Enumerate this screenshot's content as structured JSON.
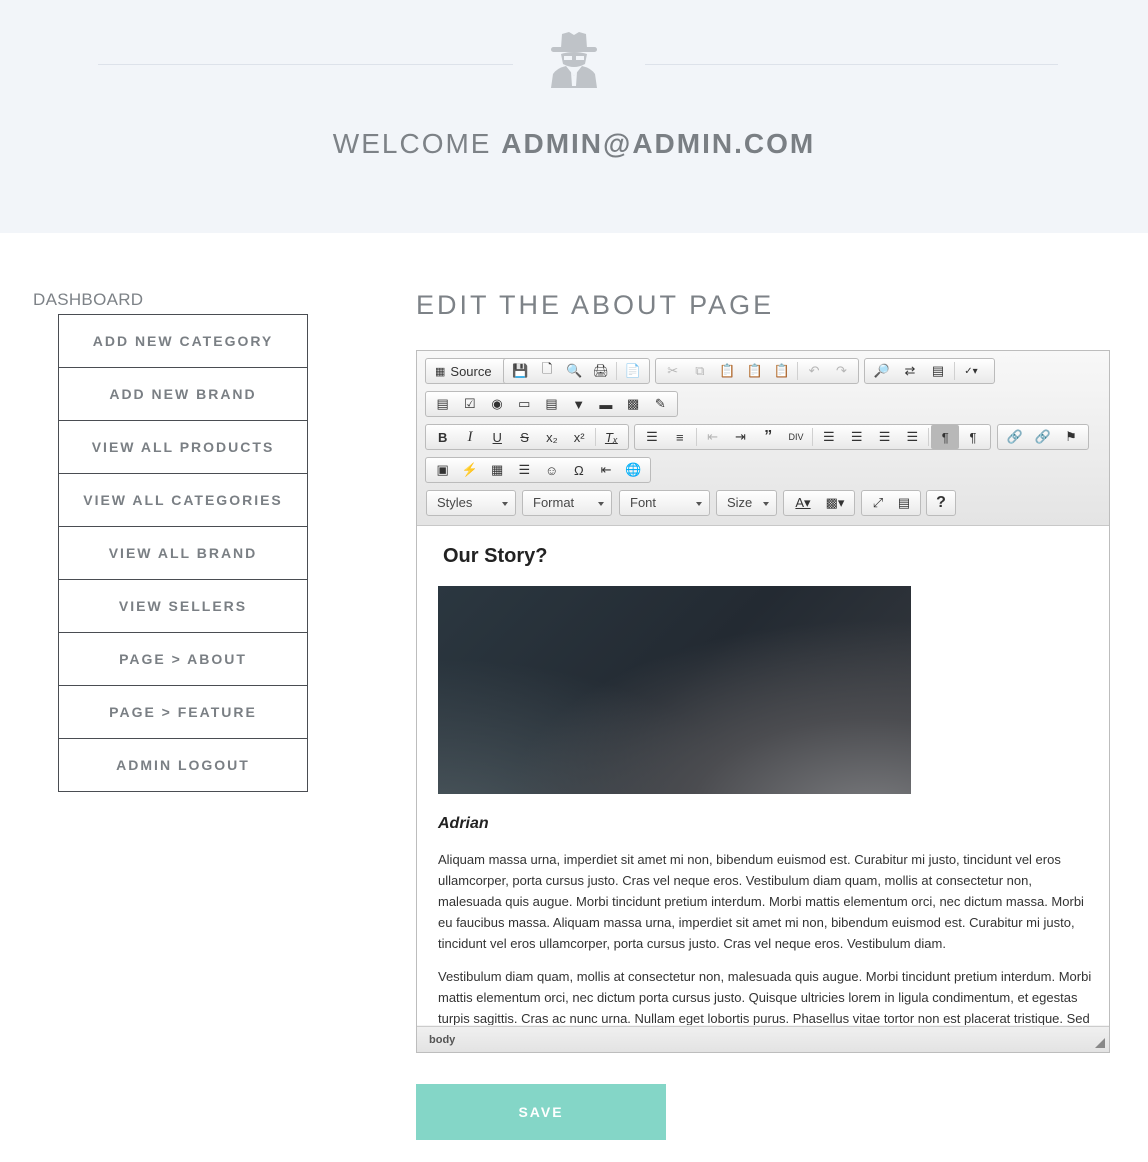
{
  "header": {
    "welcome_prefix": "WELCOME ",
    "welcome_user": "ADMIN@ADMIN.COM",
    "logo_icon": "spy-icon"
  },
  "sidebar": {
    "title": "DASHBOARD",
    "items": [
      {
        "label": "ADD NEW CATEGORY"
      },
      {
        "label": "ADD NEW BRAND"
      },
      {
        "label": "VIEW ALL PRODUCTS"
      },
      {
        "label": "VIEW ALL CATEGORIES"
      },
      {
        "label": "VIEW ALL BRAND"
      },
      {
        "label": "VIEW SELLERS"
      },
      {
        "label": "PAGE > ABOUT"
      },
      {
        "label": "PAGE > FEATURE"
      },
      {
        "label": "ADMIN LOGOUT"
      }
    ]
  },
  "main": {
    "title": "EDIT THE ABOUT PAGE",
    "save_label": "SAVE"
  },
  "editor": {
    "toolbar": {
      "source_label": "Source",
      "styles_label": "Styles",
      "format_label": "Format",
      "font_label": "Font",
      "size_label": "Size",
      "help_label": "?"
    },
    "content": {
      "heading": "Our Story?",
      "author": "Adrian",
      "paragraph_1": "Aliquam massa urna, imperdiet sit amet mi non, bibendum euismod est. Curabitur mi justo, tincidunt vel eros ullamcorper, porta cursus justo. Cras vel neque eros. Vestibulum diam quam, mollis at consectetur non, malesuada quis augue. Morbi tincidunt pretium interdum. Morbi mattis elementum orci, nec dictum massa. Morbi eu faucibus massa. Aliquam massa urna, imperdiet sit amet mi non, bibendum euismod est. Curabitur mi justo, tincidunt vel eros ullamcorper, porta cursus justo. Cras vel neque eros. Vestibulum diam.",
      "paragraph_2": "Vestibulum diam quam, mollis at consectetur non, malesuada quis augue. Morbi tincidunt pretium interdum. Morbi mattis elementum orci, nec dictum porta cursus justo. Quisque ultricies lorem in ligula condimentum, et egestas turpis sagittis. Cras ac nunc urna. Nullam eget lobortis purus. Phasellus vitae tortor non est placerat tristique. Sed"
    },
    "status_path": "body"
  },
  "colors": {
    "hero_bg": "#f2f5f9",
    "save_bg": "#84d6c7",
    "text_gray": "#7d8287"
  }
}
